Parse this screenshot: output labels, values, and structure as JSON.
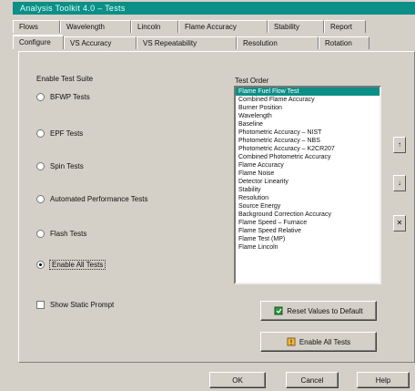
{
  "window": {
    "title": "Analysis Toolkit 4.0 – Tests"
  },
  "tabs_row1": [
    "Flows",
    "Wavelength",
    "Lincoln",
    "Flame Accuracy",
    "Stability",
    "Report"
  ],
  "tabs_row2": [
    "Configure",
    "VS Accuracy",
    "VS Repeatability",
    "Resolution",
    "Rotation"
  ],
  "active_tab": "Configure",
  "enable_group_label": "Enable Test Suite",
  "radios": [
    {
      "label": "BFWP Tests",
      "checked": false,
      "focused": false
    },
    {
      "label": "EPF Tests",
      "checked": false,
      "focused": false
    },
    {
      "label": "Spin Tests",
      "checked": false,
      "focused": false
    },
    {
      "label": "Automated Performance Tests",
      "checked": false,
      "focused": false
    },
    {
      "label": "Flash Tests",
      "checked": false,
      "focused": false
    },
    {
      "label": "Enable All Tests",
      "checked": true,
      "focused": true
    }
  ],
  "test_order_label": "Test Order",
  "test_list": [
    "Flame Fuel Flow Test",
    "Combined Flame Accuracy",
    "Burner Position",
    "Wavelength",
    "Baseline",
    "Photometric Accuracy – NIST",
    "Photometric Accuracy – NBS",
    "Photometric Accuracy – K2CR207",
    "Combined Photometric Accuracy",
    "Flame Accuracy",
    "Flame Noise",
    "Detector Linearity",
    "Stability",
    "Resolution",
    "Source Energy",
    "Background Correction Accuracy",
    "Flame Speed – Furnace",
    "Flame Speed Relative",
    "Flame Test (MP)",
    "Flame Lincoln"
  ],
  "selected_index": 0,
  "order_buttons": [
    "↑",
    "↓",
    "✕"
  ],
  "checkbox": {
    "label": "Show Static Prompt",
    "checked": false
  },
  "reset_button": "Reset Values to Default",
  "enable_all_button": "Enable All Tests",
  "footer_buttons": {
    "ok": "OK",
    "cancel": "Cancel",
    "help": "Help"
  },
  "colors": {
    "titlebar": "#0c8f86",
    "selection": "#0c8f86",
    "dialog": "#d4d0c8"
  }
}
